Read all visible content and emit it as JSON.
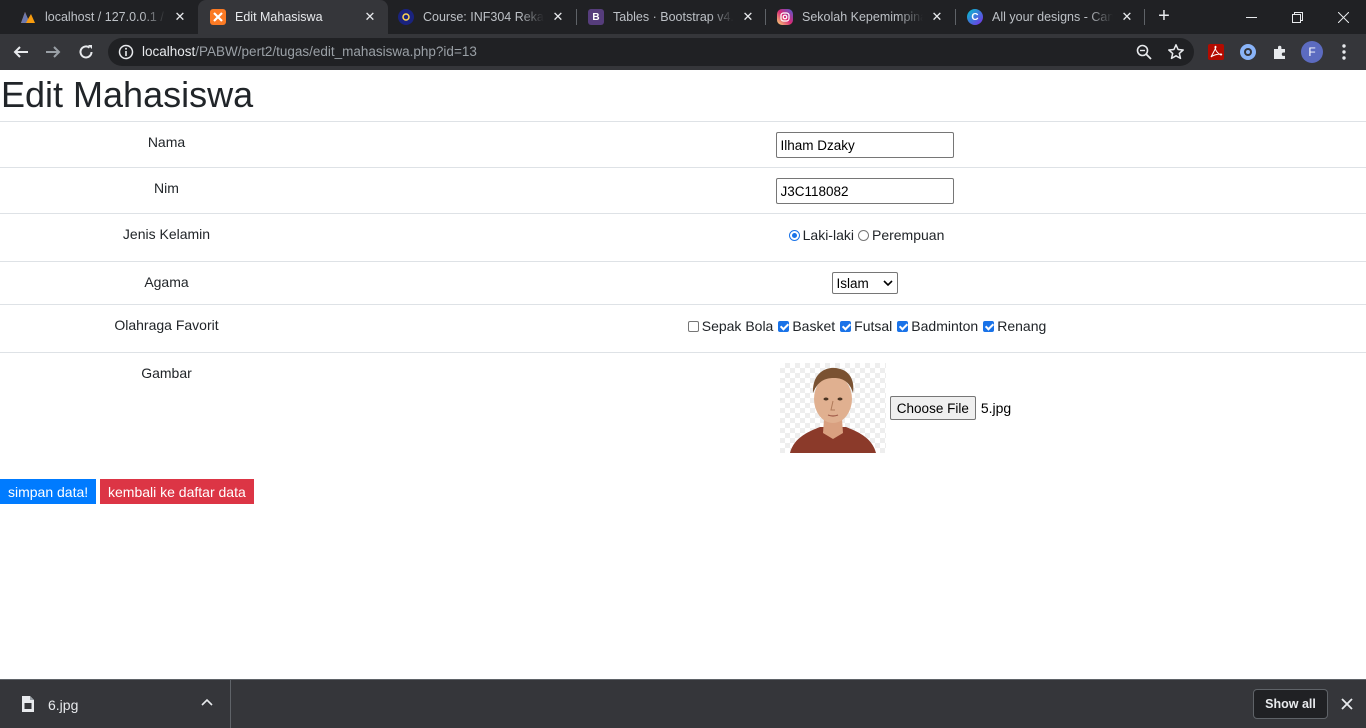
{
  "browser": {
    "tabs": [
      {
        "title": "localhost / 127.0.0.1 / p",
        "favicon": "phpmyadmin-icon",
        "favicon_color": "#f89c0e",
        "active": false
      },
      {
        "title": "Edit Mahasiswa",
        "favicon": "xampp-icon",
        "favicon_color": "#fb7a24",
        "active": true
      },
      {
        "title": "Course: INF304 Rekayas",
        "favicon": "moodle-icon",
        "favicon_color": "#1a237e",
        "active": false
      },
      {
        "title": "Tables · Bootstrap v4.5",
        "favicon": "bootstrap-icon",
        "favicon_color": "#563d7c",
        "active": false
      },
      {
        "title": "Sekolah Kepemimpinan",
        "favicon": "instagram-icon",
        "favicon_color": "#d62976",
        "active": false
      },
      {
        "title": "All your designs - Canva",
        "favicon": "canva-icon",
        "favicon_color": "#3b82f6",
        "active": false
      }
    ],
    "url_host": "localhost",
    "url_path": "/PABW/pert2/tugas/edit_mahasiswa.php?id=13",
    "profile_initial": "F"
  },
  "page": {
    "heading": "Edit Mahasiswa",
    "fields": {
      "nama": {
        "label": "Nama",
        "value": "Ilham Dzaky"
      },
      "nim": {
        "label": "Nim",
        "value": "J3C118082"
      },
      "jenis_kelamin": {
        "label": "Jenis Kelamin",
        "options": [
          "Laki-laki",
          "Perempuan"
        ],
        "selected": "Laki-laki"
      },
      "agama": {
        "label": "Agama",
        "value": "Islam"
      },
      "olahraga": {
        "label": "Olahraga Favorit",
        "options": [
          {
            "label": "Sepak Bola",
            "checked": false
          },
          {
            "label": "Basket",
            "checked": true
          },
          {
            "label": "Futsal",
            "checked": true
          },
          {
            "label": "Badminton",
            "checked": true
          },
          {
            "label": "Renang",
            "checked": true
          }
        ]
      },
      "gambar": {
        "label": "Gambar",
        "button": "Choose File",
        "file_name": "5.jpg"
      }
    },
    "buttons": {
      "save": "simpan data!",
      "back": "kembali ke daftar data"
    },
    "colors": {
      "primary": "#007bff",
      "danger": "#dc3545"
    }
  },
  "downloads": {
    "file_name": "6.jpg",
    "show_all": "Show all"
  }
}
